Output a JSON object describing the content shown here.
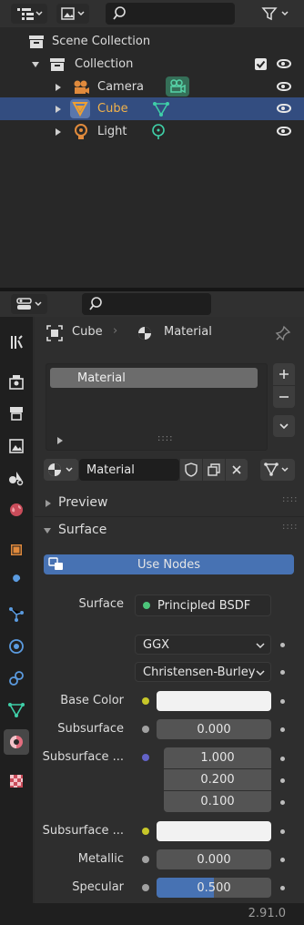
{
  "outliner": {
    "rows": [
      {
        "label": "Scene Collection"
      },
      {
        "label": "Collection"
      },
      {
        "label": "Camera"
      },
      {
        "label": "Cube"
      },
      {
        "label": "Light"
      }
    ]
  },
  "properties": {
    "breadcrumb": {
      "object": "Cube",
      "material": "Material"
    },
    "material_slot": "Material",
    "material_name": "Material",
    "panels": {
      "preview": "Preview",
      "surface": "Surface"
    },
    "use_nodes": "Use Nodes",
    "surface": {
      "label": "Surface",
      "value": "Principled BSDF"
    },
    "distribution": "GGX",
    "subsurface_method": "Christensen-Burley",
    "params": {
      "base_color": "Base Color",
      "subsurface": {
        "label": "Subsurface",
        "value": "0.000"
      },
      "subsurface_radius": {
        "label": "Subsurface ...",
        "values": [
          "1.000",
          "0.200",
          "0.100"
        ]
      },
      "subsurface_color": "Subsurface ...",
      "metallic": {
        "label": "Metallic",
        "value": "0.000"
      },
      "specular": {
        "label": "Specular",
        "value": "0.500",
        "fraction": 0.5
      }
    }
  },
  "status": {
    "version": "2.91.0"
  },
  "colors": {
    "selection": "#334d80",
    "accent_blue": "#4772b3",
    "node_green": "#4cc47a",
    "socket_yellow": "#c7c729",
    "socket_gray": "#a1a1a1",
    "socket_purple": "#6363c7"
  }
}
